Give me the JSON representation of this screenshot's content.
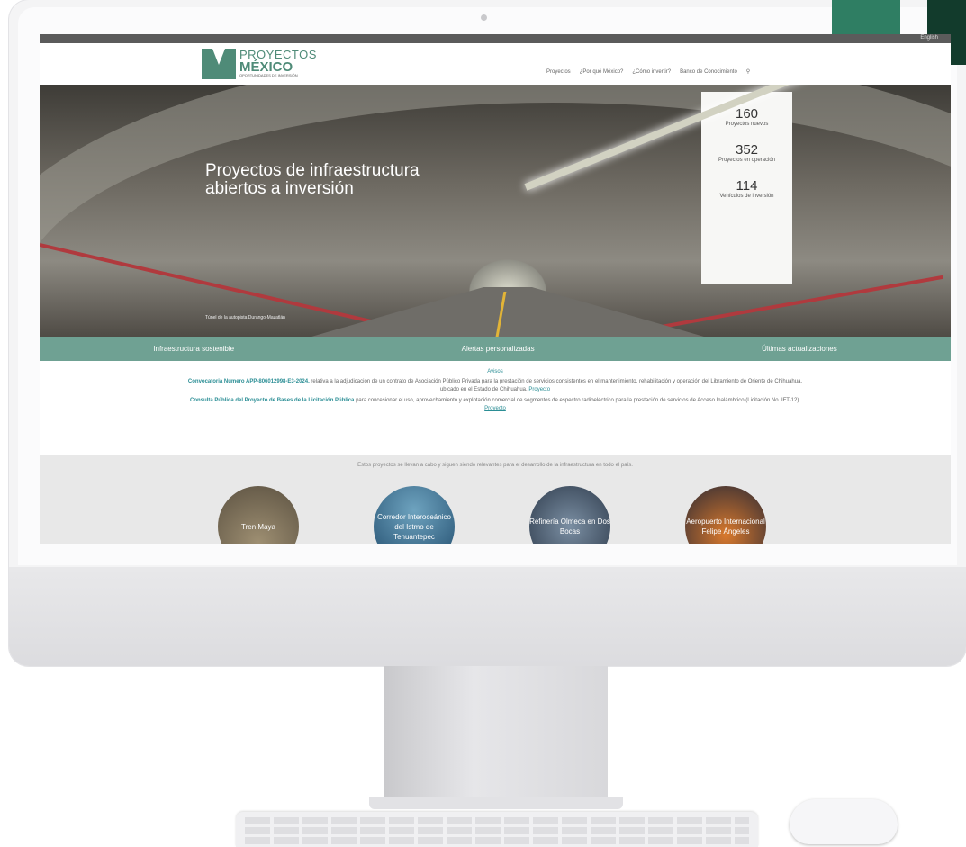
{
  "site": {
    "lang_link": "English",
    "logo": {
      "line1": "PROYECTOS",
      "line2": "MÉXICO",
      "line3": "OPORTUNIDADES DE INVERSIÓN"
    },
    "nav": [
      "Proyectos",
      "¿Por qué México?",
      "¿Cómo invertir?",
      "Banco de Conocimiento"
    ]
  },
  "hero": {
    "title": "Proyectos de infraestructura abiertos a inversión",
    "credit": "Túnel de la autopista Durango-Mazatlán",
    "stats": [
      {
        "number": "160",
        "label": "Proyectos nuevos"
      },
      {
        "number": "352",
        "label": "Proyectos en operación"
      },
      {
        "number": "114",
        "label": "Vehículos de inversión"
      }
    ]
  },
  "tabs": [
    "Infraestructura sostenible",
    "Alertas personalizadas",
    "Últimas actualizaciones"
  ],
  "news": {
    "heading": "Avisos",
    "item1_lead": "Convocatoria Número APP-806012998-E3-2024,",
    "item1_text": "relativa a la adjudicación de un contrato de Asociación Público Privada para la prestación de servicios consistentes en el mantenimiento, rehabilitación y operación del Libramiento de Oriente de Chihuahua, ubicado en el Estado de Chihuahua.",
    "item1_link": "Proyecto",
    "item2_lead": "Consulta Pública del Proyecto de Bases de la Licitación Pública",
    "item2_text": "para concesionar el uso, aprovechamiento y explotación comercial de segmentos de espectro radioeléctrico para la prestación de servicios de Acceso Inalámbrico (Licitación No. IFT-12).",
    "item2_link": "Proyecto"
  },
  "projects": {
    "intro": "Estos proyectos se llevan a cabo y siguen siendo relevantes para el desarrollo de la infraestructura en todo el país.",
    "items": [
      "Tren Maya",
      "Corredor Interoceánico del Istmo de Tehuantepec",
      "Refinería Olmeca en Dos Bocas",
      "Aeropuerto Internacional Felipe Ángeles"
    ]
  }
}
